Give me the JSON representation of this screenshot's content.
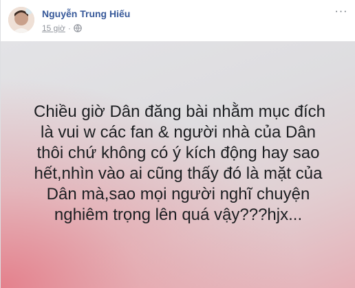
{
  "post": {
    "author_name": "Nguyễn Trung Hiếu",
    "timestamp": "15 giờ",
    "separator": "·",
    "privacy_icon": "globe-icon",
    "more_icon": "ellipsis-icon",
    "more_label": "···",
    "status_lines": [
      "Chiều giờ Dân đăng bài nhằm mục đích",
      "là vui w các fan & người nhà của Dân",
      "thôi chứ không có ý kích động hay sao",
      "hết,nhìn vào ai cũng thấy đó là mặt của",
      "Dân mà,sao mọi người nghĩ chuyện",
      "nghiêm trọng lên quá vậy???hjx..."
    ]
  },
  "colors": {
    "author_link": "#365899",
    "meta_text": "#90949c",
    "status_text": "#1c1e21",
    "background_top": "#e3e3e6",
    "background_corner": "#e47c88"
  }
}
